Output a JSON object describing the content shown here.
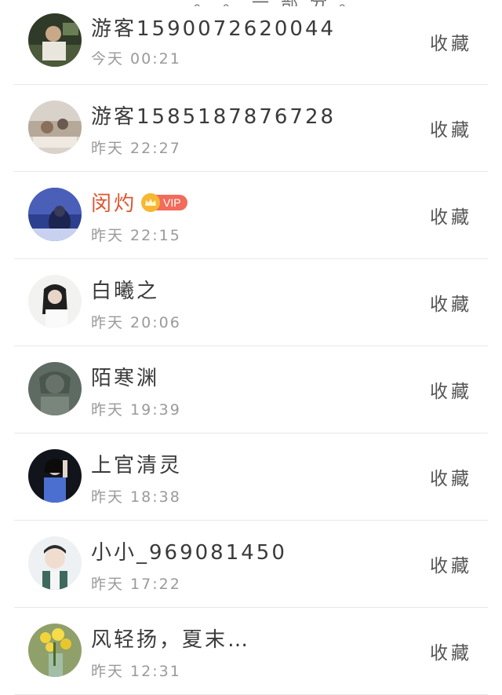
{
  "top_partial_text": "… 。 。 一 部 分 。",
  "collect_label": "收藏",
  "visitors": [
    {
      "name": "游客1590072620044",
      "time": "今天 00:21",
      "vip": false
    },
    {
      "name": "游客1585187876728",
      "time": "昨天 22:27",
      "vip": false
    },
    {
      "name": "闵灼",
      "time": "昨天 22:15",
      "vip": true,
      "vip_label": "VIP"
    },
    {
      "name": "白曦之",
      "time": "昨天 20:06",
      "vip": false
    },
    {
      "name": "陌寒渊",
      "time": "昨天 19:39",
      "vip": false
    },
    {
      "name": "上官清灵",
      "time": "昨天 18:38",
      "vip": false
    },
    {
      "name": "小小_969081450",
      "time": "昨天 17:22",
      "vip": false
    },
    {
      "name": "风轻扬，夏末…",
      "time": "昨天 12:31",
      "vip": false
    }
  ],
  "colors": {
    "vip_name": "#e0552f",
    "vip_badge": "#f26b5b",
    "vip_crown": "#f7b733",
    "divider": "#e8e8e8"
  }
}
